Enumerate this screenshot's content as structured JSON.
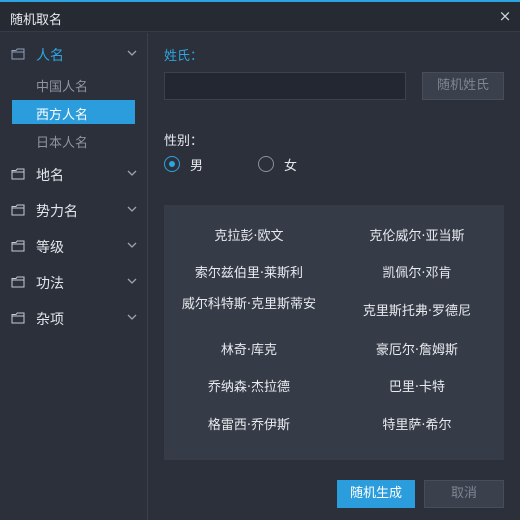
{
  "window": {
    "title": "随机取名",
    "close_glyph": "×"
  },
  "sidebar": {
    "categories": [
      {
        "label": "人名",
        "icon": "folder-icon",
        "expanded": true,
        "subitems": [
          "中国人名",
          "西方人名",
          "日本人名"
        ],
        "selected": "西方人名"
      },
      {
        "label": "地名",
        "icon": "folder-icon"
      },
      {
        "label": "势力名",
        "icon": "folder-icon"
      },
      {
        "label": "等级",
        "icon": "folder-icon"
      },
      {
        "label": "功法",
        "icon": "folder-icon"
      },
      {
        "label": "杂项",
        "icon": "folder-icon"
      }
    ]
  },
  "form": {
    "surname_label": "姓氏：",
    "surname_value": "",
    "random_surname_button": "随机姓氏",
    "gender_label": "性别：",
    "gender_options": [
      "男",
      "女"
    ],
    "gender_selected": "男"
  },
  "results": {
    "names": [
      [
        "克拉彭·欧文",
        "克伦威尔·亚当斯"
      ],
      [
        "索尔兹伯里·莱斯利",
        "凯佩尔·邓肯"
      ],
      [
        "威尔科特斯·克里斯蒂安",
        "克里斯托弗·罗德尼"
      ],
      [
        "林奇·库克",
        "豪厄尔·詹姆斯"
      ],
      [
        "乔纳森·杰拉德",
        "巴里·卡特"
      ],
      [
        "格雷西·乔伊斯",
        "特里萨·希尔"
      ]
    ]
  },
  "footer": {
    "generate_button": "随机生成",
    "cancel_button": "取消"
  },
  "colors": {
    "accent": "#2b9ddc",
    "background": "#2b303b",
    "panel": "#353b47",
    "titlebar": "#262a33"
  }
}
